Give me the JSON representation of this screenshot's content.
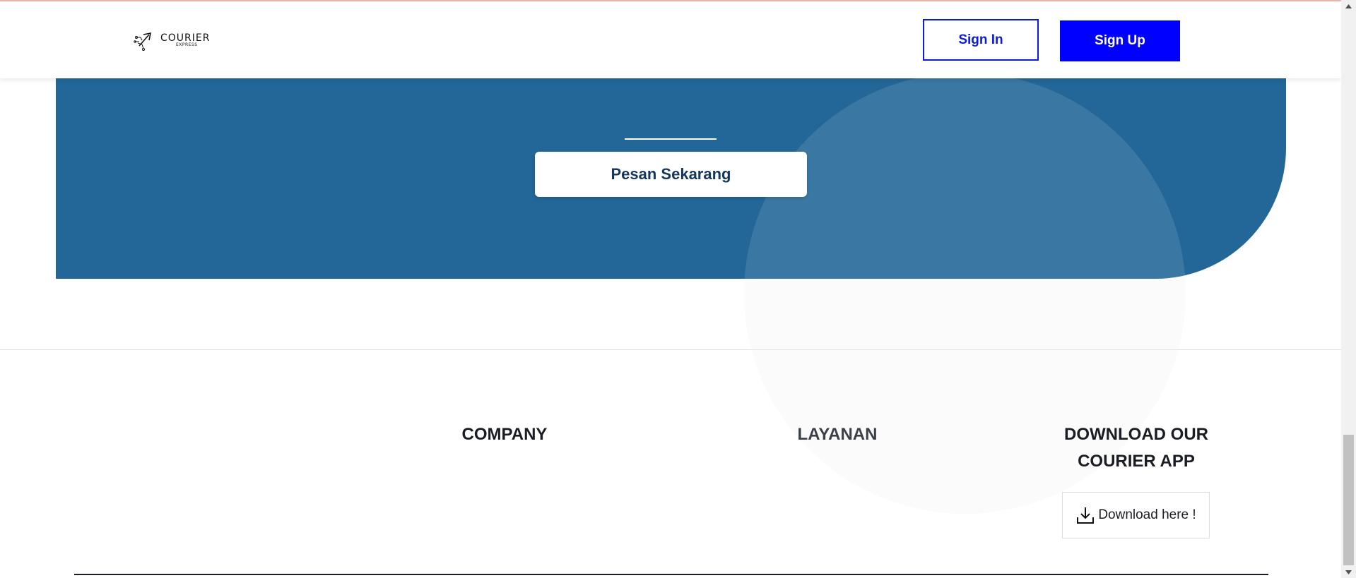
{
  "header": {
    "logo_text": "COURIER",
    "logo_subtext": "EXPRESS",
    "sign_in_label": "Sign In",
    "sign_up_label": "Sign Up"
  },
  "hero": {
    "cta_label": "Pesan Sekarang"
  },
  "footer": {
    "company_heading": "COMPANY",
    "layanan_heading": "LAYANAN",
    "download_heading": "DOWNLOAD OUR COURIER APP",
    "download_button_label": "Download here !"
  },
  "colors": {
    "primary_blue": "#0000ff",
    "hero_blue": "#226797",
    "cta_text": "#14375a"
  },
  "icons": {
    "logo": "delivery-arrow-logo-icon",
    "download": "download-icon",
    "scroll_up": "arrow-up-icon",
    "scroll_down": "arrow-down-icon"
  }
}
